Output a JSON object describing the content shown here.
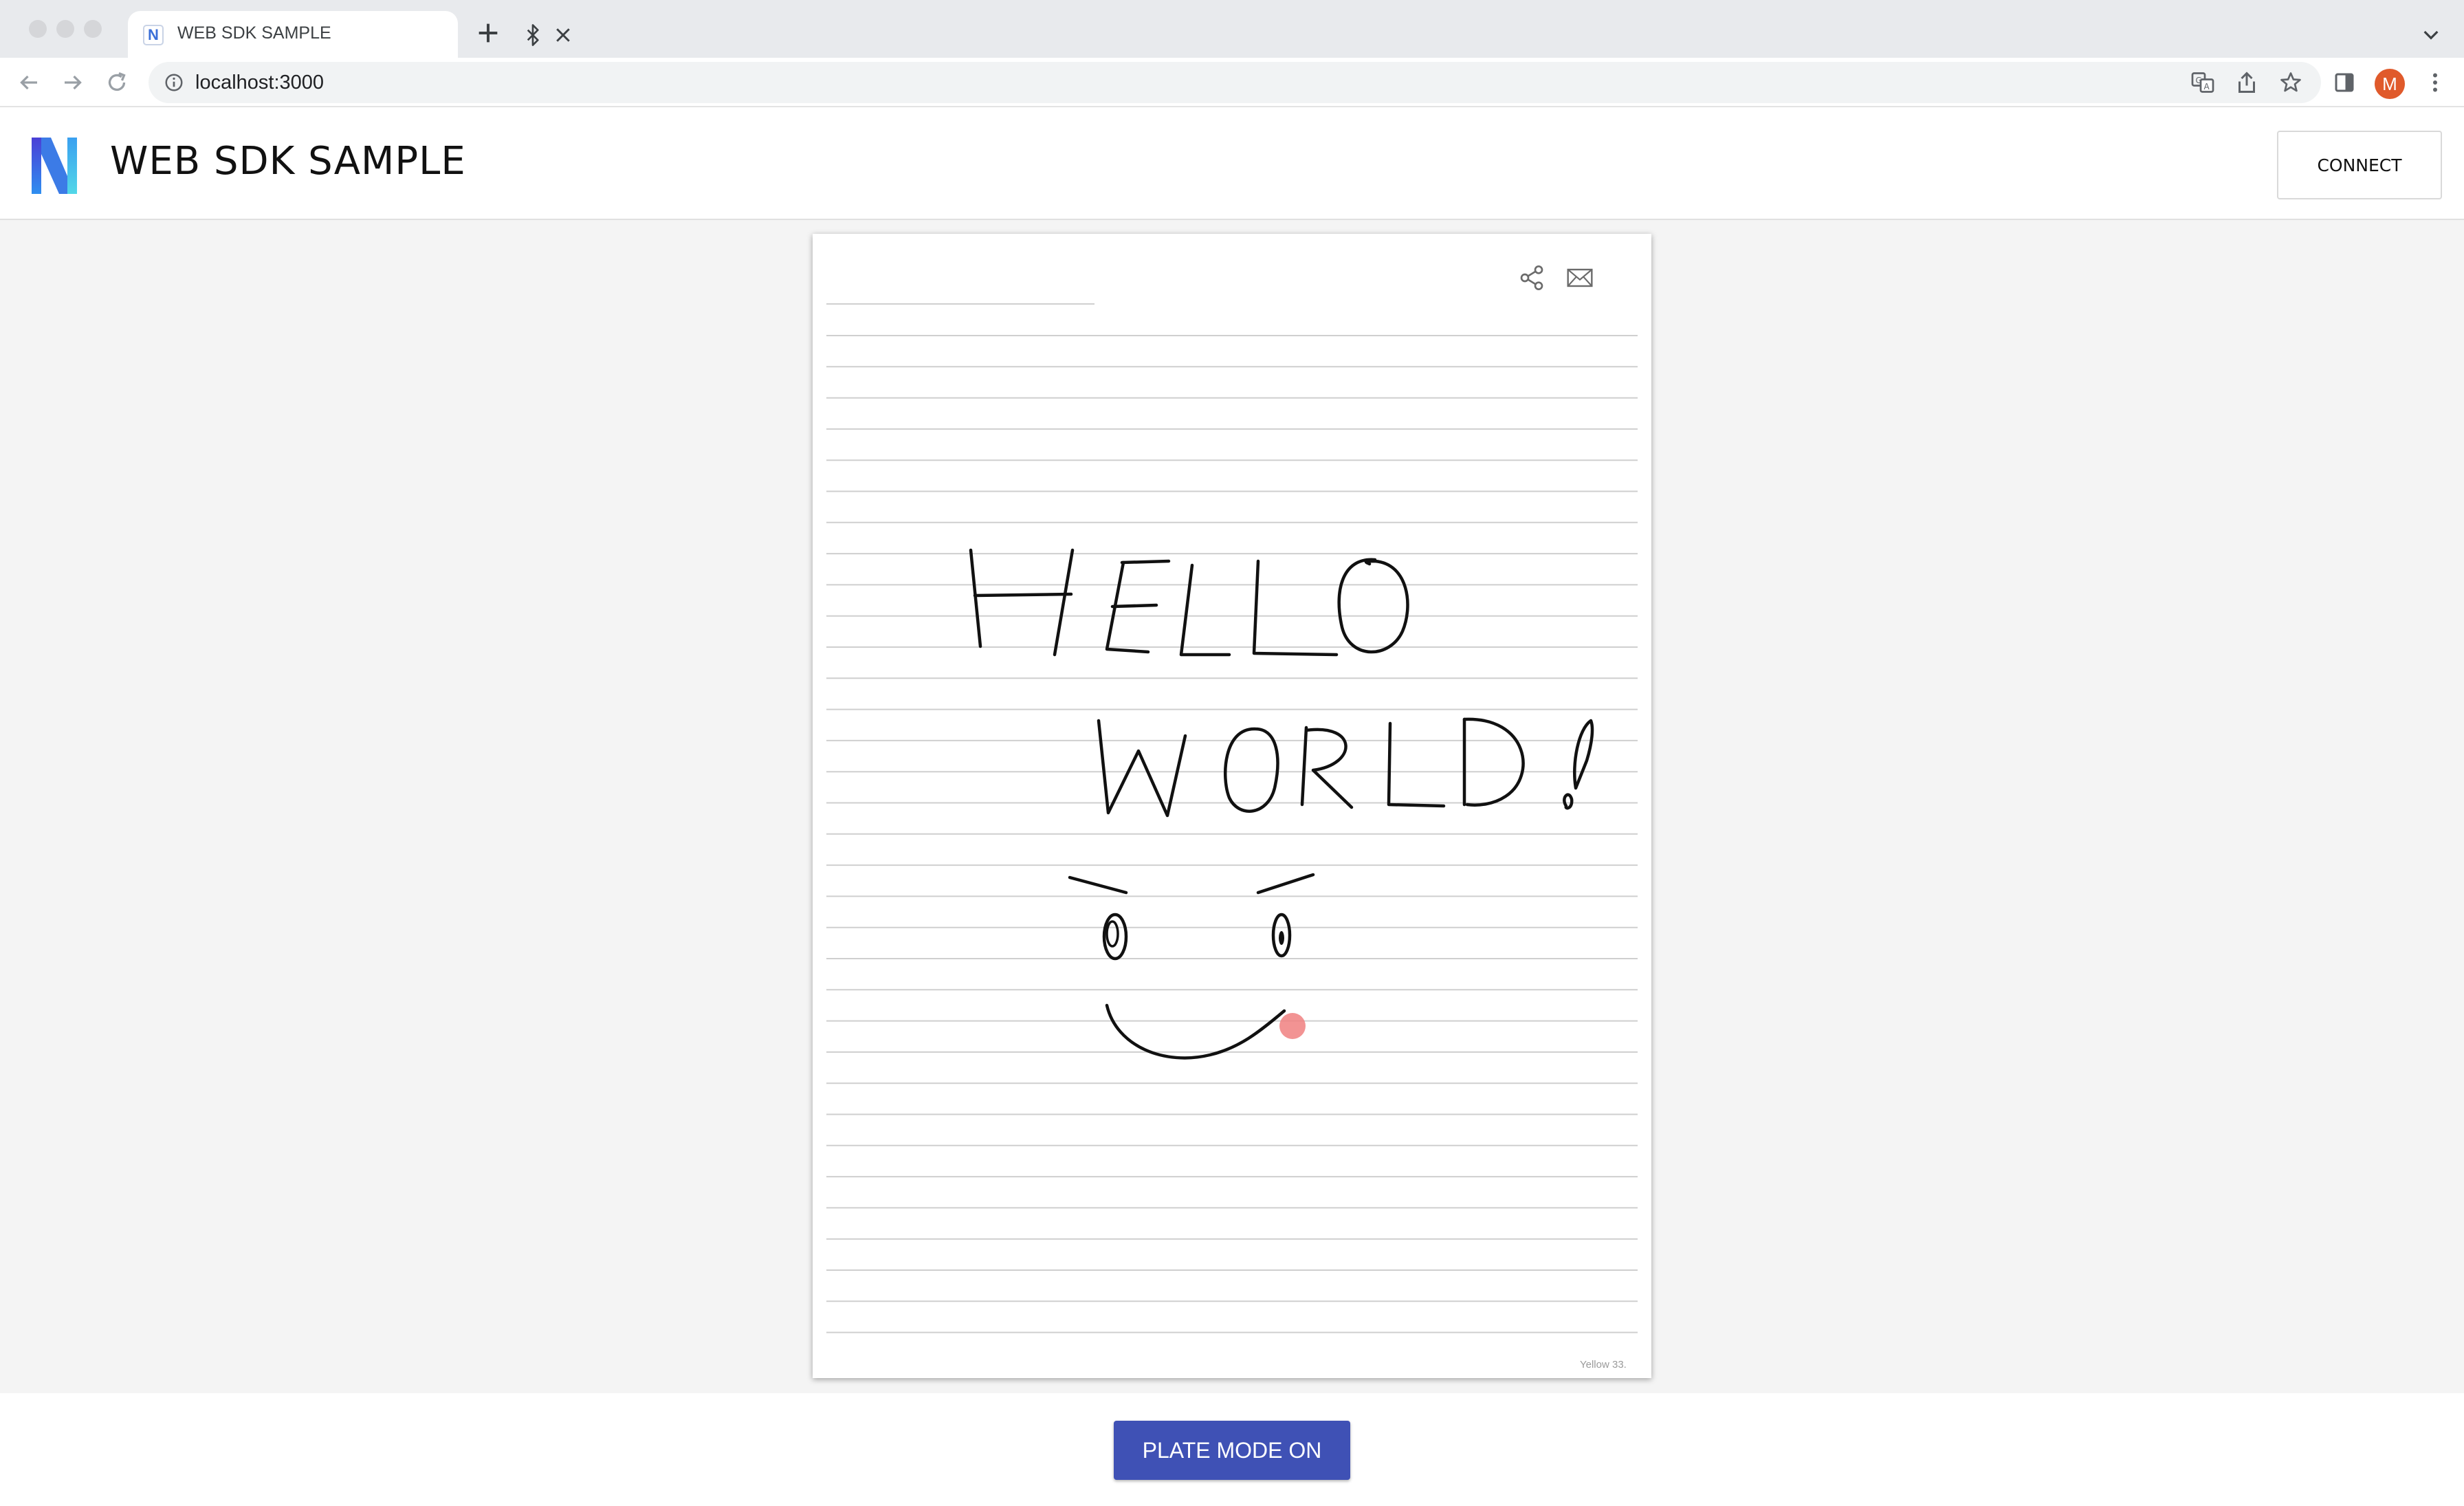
{
  "browser": {
    "tab_title": "WEB SDK SAMPLE",
    "tab_favicon_letter": "N",
    "url": "localhost:3000",
    "profile_initial": "M"
  },
  "app": {
    "title": "WEB SDK SAMPLE",
    "connect_label": "CONNECT",
    "plate_mode_label": "PLATE MODE ON",
    "accent_color": "#3f51b5"
  },
  "notebook": {
    "footer_text": "Yellow 33.",
    "handwriting": [
      "HELLO",
      "WORLD!"
    ],
    "pen_cursor_color": "#f08080"
  }
}
